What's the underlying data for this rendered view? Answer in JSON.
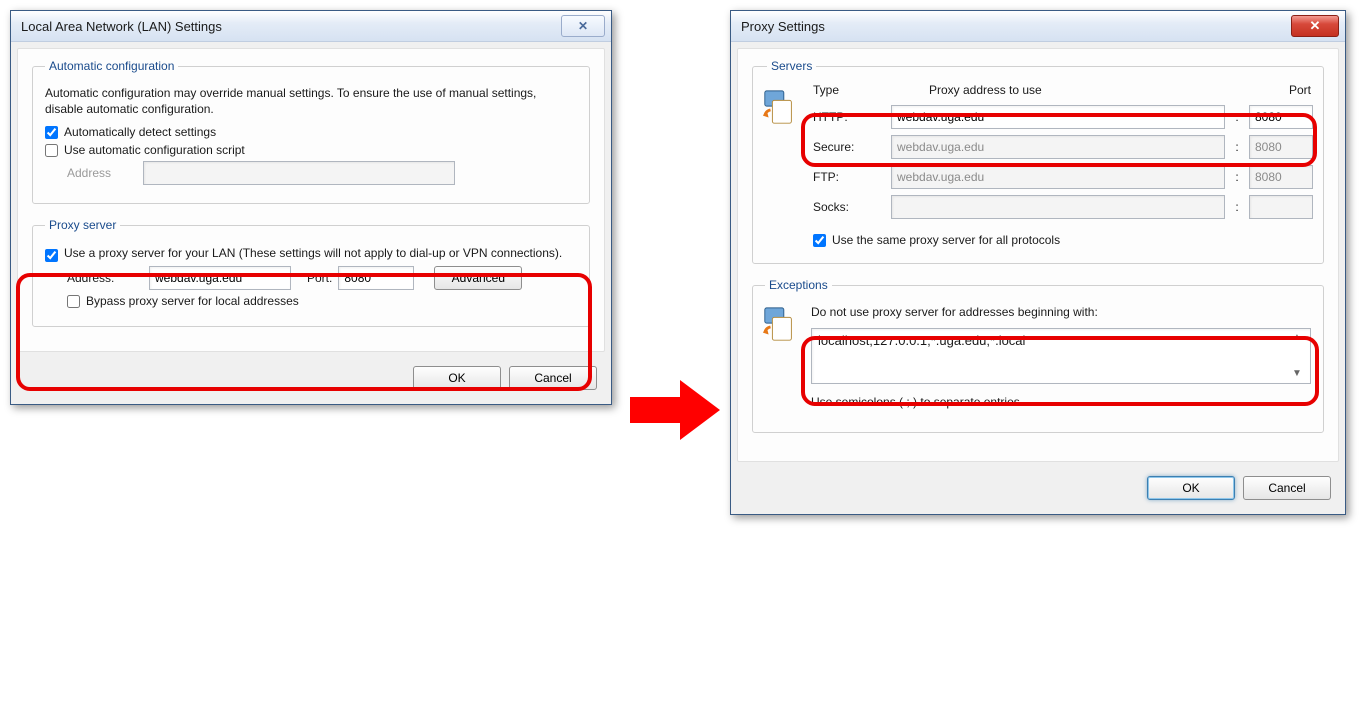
{
  "lan": {
    "title": "Local Area Network (LAN) Settings",
    "auto": {
      "legend": "Automatic configuration",
      "desc": "Automatic configuration may override manual settings.  To ensure the use of manual settings, disable automatic configuration.",
      "detect_label": "Automatically detect settings",
      "detect_checked": true,
      "script_label": "Use automatic configuration script",
      "script_checked": false,
      "address_label": "Address",
      "address_value": ""
    },
    "proxy": {
      "legend": "Proxy server",
      "use_label": "Use a proxy server for your LAN (These settings will not apply to dial-up or VPN connections).",
      "use_checked": true,
      "address_label": "Address:",
      "address_value": "webdav.uga.edu",
      "port_label": "Port:",
      "port_value": "8080",
      "advanced_label": "Advanced",
      "bypass_label": "Bypass proxy server for local addresses",
      "bypass_checked": false
    },
    "ok": "OK",
    "cancel": "Cancel"
  },
  "prx": {
    "title": "Proxy Settings",
    "servers": {
      "legend": "Servers",
      "head_type": "Type",
      "head_addr": "Proxy address to use",
      "head_port": "Port",
      "rows": [
        {
          "label": "HTTP:",
          "addr": "webdav.uga.edu",
          "port": "8080",
          "enabled": true
        },
        {
          "label": "Secure:",
          "addr": "webdav.uga.edu",
          "port": "8080",
          "enabled": false
        },
        {
          "label": "FTP:",
          "addr": "webdav.uga.edu",
          "port": "8080",
          "enabled": false
        },
        {
          "label": "Socks:",
          "addr": "",
          "port": "",
          "enabled": false
        }
      ],
      "same_label": "Use the same proxy server for all protocols",
      "same_checked": true
    },
    "exceptions": {
      "legend": "Exceptions",
      "desc": "Do not use proxy server for addresses beginning with:",
      "value": "localhost;127.0.0.1;*.uga.edu;*.local ",
      "hint": "Use semicolons ( ; ) to separate entries."
    },
    "ok": "OK",
    "cancel": "Cancel"
  }
}
